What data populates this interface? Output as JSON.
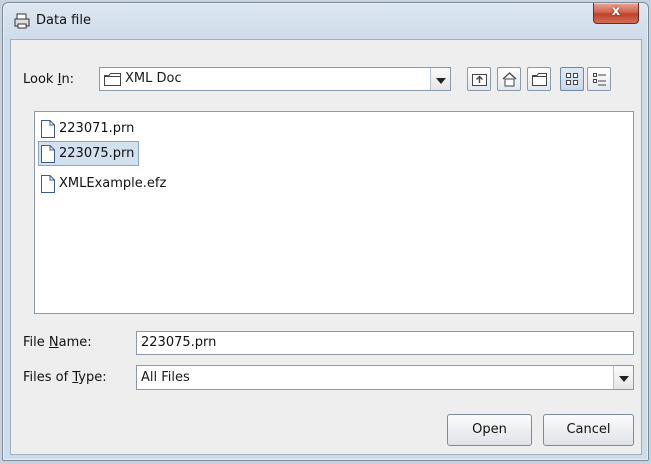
{
  "window": {
    "title": "Data file",
    "close_label": "x"
  },
  "look_in": {
    "label_pre": "Look ",
    "label_mnemonic": "I",
    "label_post": "n:",
    "value": "XML Doc",
    "value_icon": "folder-icon"
  },
  "toolbar": {
    "buttons": [
      {
        "name": "up-one-level",
        "icon": "up-folder-icon"
      },
      {
        "name": "home",
        "icon": "home-icon"
      },
      {
        "name": "new-folder",
        "icon": "new-folder-icon"
      },
      {
        "name": "list-view",
        "icon": "list-view-icon",
        "active": true
      },
      {
        "name": "details-view",
        "icon": "details-view-icon"
      }
    ]
  },
  "files": [
    {
      "name": "223071.prn",
      "icon": "file-icon",
      "selected": false
    },
    {
      "name": "223075.prn",
      "icon": "file-icon",
      "selected": true
    },
    {
      "name": "XMLExample.efz",
      "icon": "file-icon",
      "selected": false
    }
  ],
  "file_name": {
    "label_pre": "File ",
    "label_mnemonic": "N",
    "label_post": "ame:",
    "value": "223075.prn"
  },
  "file_type": {
    "label_pre": "Files of ",
    "label_mnemonic": "T",
    "label_post": "ype:",
    "value": "All Files"
  },
  "buttons": {
    "open": "Open",
    "cancel": "Cancel"
  }
}
